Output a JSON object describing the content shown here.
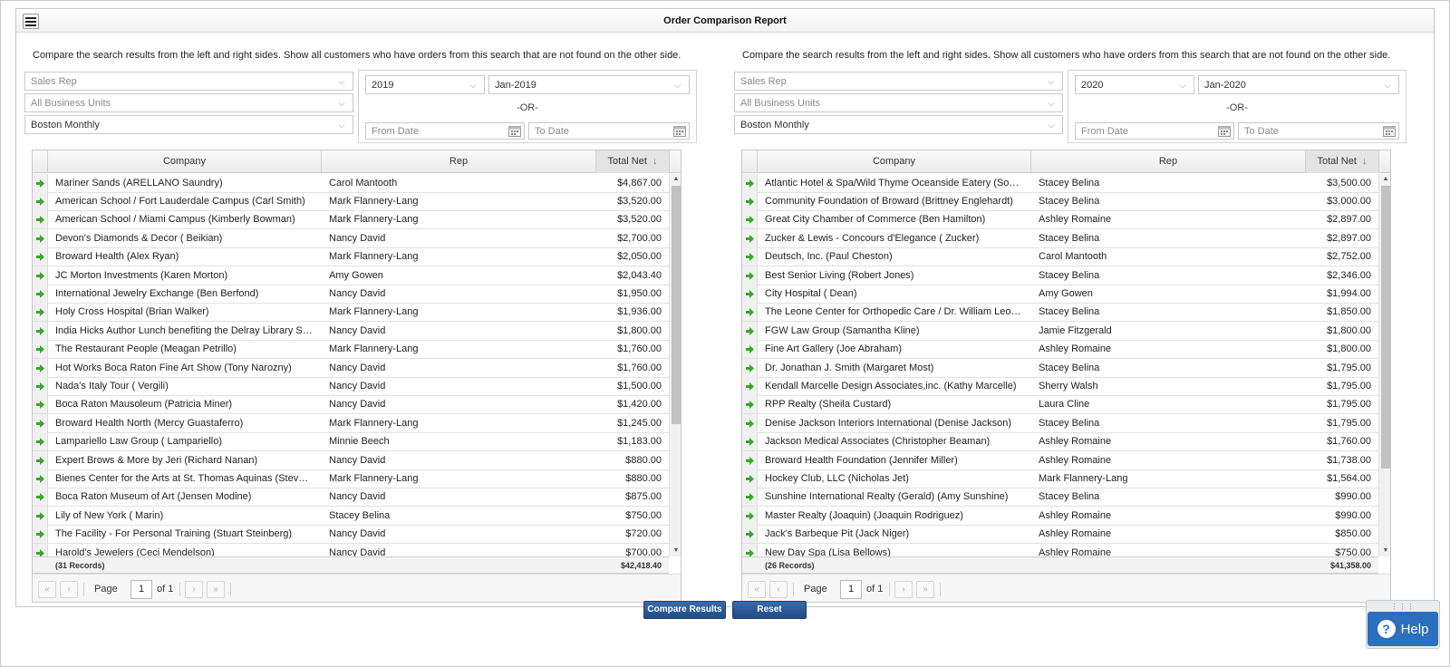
{
  "page_title": "Order Comparison Report",
  "description": "Compare the search results from the left and right sides. Show all customers who have orders from this search that are not found on the other side.",
  "columns": {
    "company": "Company",
    "rep": "Rep",
    "total_net": "Total Net"
  },
  "pager": {
    "page_label": "Page",
    "page_value": "1",
    "of_label": "of 1"
  },
  "buttons": {
    "compare": "Compare Results",
    "reset": "Reset",
    "help": "Help"
  },
  "icons": {
    "menu": "hamburger-menu-icon",
    "expander": "green-arrow-right-icon",
    "calendar": "calendar-icon",
    "chevron": "chevron-down-icon",
    "sort": "sort-descending-icon",
    "help": "question-circle-icon"
  },
  "colors": {
    "primary_button": "#2b5a96",
    "help_button": "#2b6fbf",
    "expander_arrow": "#3aa52c"
  },
  "left": {
    "sales_rep": "Sales Rep",
    "business_units": "All Business Units",
    "search": "Boston Monthly",
    "year": "2019",
    "month": "Jan-2019",
    "or_label": "-OR-",
    "from_date": "From Date",
    "to_date": "To Date",
    "records": "(31 Records)",
    "total": "$42,418.40",
    "rows": [
      {
        "company": "Mariner Sands (ARELLANO Saundry)",
        "rep": "Carol Mantooth",
        "net": "$4,867.00"
      },
      {
        "company": "American School / Fort Lauderdale Campus (Carl Smith)",
        "rep": "Mark Flannery-Lang",
        "net": "$3,520.00"
      },
      {
        "company": "American School / Miami Campus (Kimberly Bowman)",
        "rep": "Mark Flannery-Lang",
        "net": "$3,520.00"
      },
      {
        "company": "Devon's Diamonds & Decor ( Beikian)",
        "rep": "Nancy David",
        "net": "$2,700.00"
      },
      {
        "company": "Broward Health (Alex Ryan)",
        "rep": "Mark Flannery-Lang",
        "net": "$2,050.00"
      },
      {
        "company": "JC Morton Investments (Karen Morton)",
        "rep": "Amy Gowen",
        "net": "$2,043.40"
      },
      {
        "company": "International Jewelry Exchange (Ben Berfond)",
        "rep": "Nancy David",
        "net": "$1,950.00"
      },
      {
        "company": "Holy Cross Hospital (Brian Walker)",
        "rep": "Mark Flannery-Lang",
        "net": "$1,936.00"
      },
      {
        "company": "India Hicks Author Lunch benefiting the Delray Library Sp...",
        "rep": "Nancy David",
        "net": "$1,800.00"
      },
      {
        "company": "The Restaurant People (Meagan Petrillo)",
        "rep": "Mark Flannery-Lang",
        "net": "$1,760.00"
      },
      {
        "company": "Hot Works Boca Raton Fine Art Show (Tony Narozny)",
        "rep": "Nancy David",
        "net": "$1,760.00"
      },
      {
        "company": "Nada's Italy Tour ( Vergili)",
        "rep": "Nancy David",
        "net": "$1,500.00"
      },
      {
        "company": "Boca Raton Mausoleum (Patricia Miner)",
        "rep": "Nancy David",
        "net": "$1,420.00"
      },
      {
        "company": "Broward Health North (Mercy Guastaferro)",
        "rep": "Mark Flannery-Lang",
        "net": "$1,245.00"
      },
      {
        "company": "Lampariello Law Group ( Lampariello)",
        "rep": "Minnie Beech",
        "net": "$1,183.00"
      },
      {
        "company": "Expert Brows & More by Jeri (Richard Nanan)",
        "rep": "Nancy David",
        "net": "$880.00"
      },
      {
        "company": "Bienes Center for the Arts at St. Thomas Aquinas (Steven ...",
        "rep": "Mark Flannery-Lang",
        "net": "$880.00"
      },
      {
        "company": "Boca Raton Museum of Art (Jensen Modine)",
        "rep": "Nancy David",
        "net": "$875.00"
      },
      {
        "company": "Lily of New York ( Marin)",
        "rep": "Stacey Belina",
        "net": "$750.00"
      },
      {
        "company": "The Facility - For Personal Training (Stuart Steinberg)",
        "rep": "Nancy David",
        "net": "$720.00"
      },
      {
        "company": "Harold's Jewelers (Ceci Mendelson)",
        "rep": "Nancy David",
        "net": "$700.00"
      }
    ]
  },
  "right": {
    "sales_rep": "Sales Rep",
    "business_units": "All Business Units",
    "search": "Boston Monthly",
    "year": "2020",
    "month": "Jan-2020",
    "or_label": "-OR-",
    "from_date": "From Date",
    "to_date": "To Date",
    "records": "(26 Records)",
    "total": "$41,358.00",
    "rows": [
      {
        "company": "Atlantic Hotel & Spa/Wild Thyme Oceanside Eatery (Socie...",
        "rep": "Stacey Belina",
        "net": "$3,500.00"
      },
      {
        "company": "Community Foundation of Broward (Brittney Englehardt)",
        "rep": "Stacey Belina",
        "net": "$3,000.00"
      },
      {
        "company": "Great City Chamber of Commerce (Ben Hamilton)",
        "rep": "Ashley Romaine",
        "net": "$2,897.00"
      },
      {
        "company": "Zucker & Lewis - Concours d'Elegance ( Zucker)",
        "rep": "Stacey Belina",
        "net": "$2,897.00"
      },
      {
        "company": "Deutsch, Inc. (Paul Cheston)",
        "rep": "Carol Mantooth",
        "net": "$2,752.00"
      },
      {
        "company": "Best Senior Living (Robert Jones)",
        "rep": "Stacey Belina",
        "net": "$2,346.00"
      },
      {
        "company": "City Hospital ( Dean)",
        "rep": "Amy Gowen",
        "net": "$1,994.00"
      },
      {
        "company": "The Leone Center for Orthopedic Care / Dr. William Leone...",
        "rep": "Stacey Belina",
        "net": "$1,850.00"
      },
      {
        "company": "FGW Law Group (Samantha Kline)",
        "rep": "Jamie Fitzgerald",
        "net": "$1,800.00"
      },
      {
        "company": "Fine Art Gallery (Joe Abraham)",
        "rep": "Ashley Romaine",
        "net": "$1,800.00"
      },
      {
        "company": "Dr. Jonathan J. Smith (Margaret Most)",
        "rep": "Stacey Belina",
        "net": "$1,795.00"
      },
      {
        "company": "Kendall Marcelle Design Associates,inc. (Kathy Marcelle)",
        "rep": "Sherry Walsh",
        "net": "$1,795.00"
      },
      {
        "company": "RPP Realty (Sheila Custard)",
        "rep": "Laura Cline",
        "net": "$1,795.00"
      },
      {
        "company": "Denise Jackson Interiors International (Denise Jackson)",
        "rep": "Stacey Belina",
        "net": "$1,795.00"
      },
      {
        "company": "Jackson Medical Associates (Christopher Beaman)",
        "rep": "Ashley Romaine",
        "net": "$1,760.00"
      },
      {
        "company": "Broward Health Foundation (Jennifer Miller)",
        "rep": "Ashley Romaine",
        "net": "$1,738.00"
      },
      {
        "company": "Hockey Club, LLC (Nicholas Jet)",
        "rep": "Mark Flannery-Lang",
        "net": "$1,564.00"
      },
      {
        "company": "Sunshine International Realty (Gerald) (Amy Sunshine)",
        "rep": "Stacey Belina",
        "net": "$990.00"
      },
      {
        "company": "Master Realty (Joaquin) (Joaquin Rodriguez)",
        "rep": "Ashley Romaine",
        "net": "$990.00"
      },
      {
        "company": "Jack's Barbeque Pit (Jack Niger)",
        "rep": "Ashley Romaine",
        "net": "$850.00"
      },
      {
        "company": "New Day Spa (Lisa Bellows)",
        "rep": "Ashley Romaine",
        "net": "$750.00"
      }
    ]
  }
}
